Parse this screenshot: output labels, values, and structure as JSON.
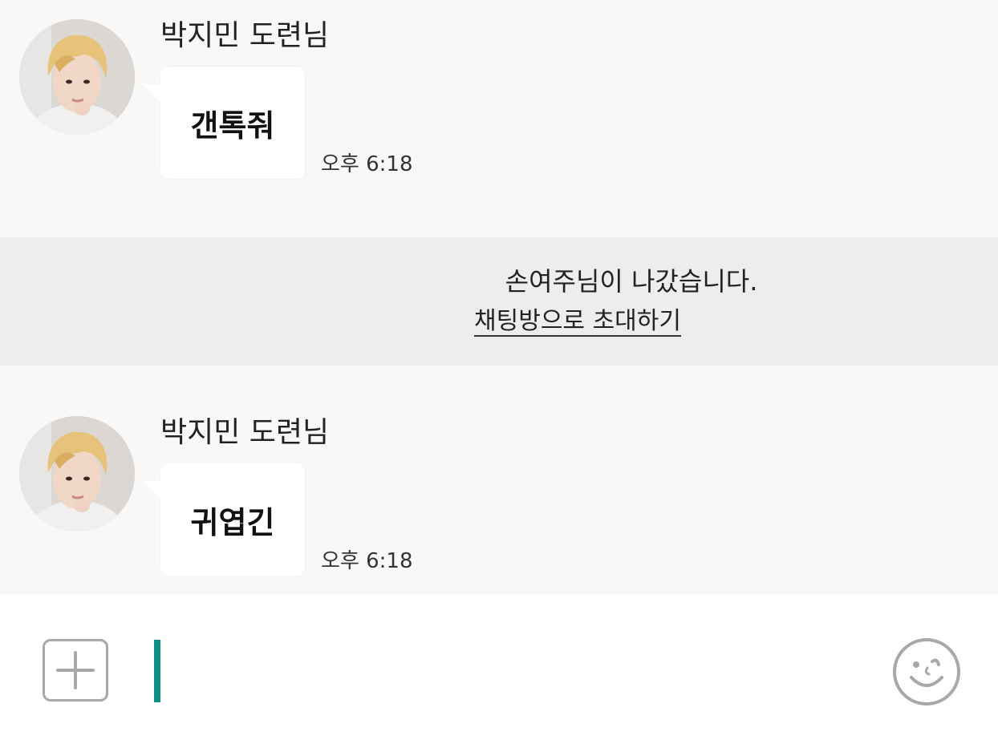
{
  "messages": [
    {
      "sender": "박지민 도련님",
      "text": "갠톡줘",
      "time": "오후 6:18"
    },
    {
      "sender": "박지민 도련님",
      "text": "귀엽긴",
      "time": "오후 6:18"
    }
  ],
  "notice": {
    "text": "손여주님이 나갔습니다.",
    "invite_link": "채팅방으로 초대하기"
  },
  "input": {
    "value": "",
    "placeholder": ""
  },
  "icons": {
    "add": "plus-icon",
    "emoticon": "smile-icon"
  },
  "colors": {
    "chat_background": "#f8f8f8",
    "notice_background": "#ededed",
    "bubble": "#ffffff",
    "cursor": "#0f8f85",
    "icon_gray": "#a8a8a8"
  }
}
